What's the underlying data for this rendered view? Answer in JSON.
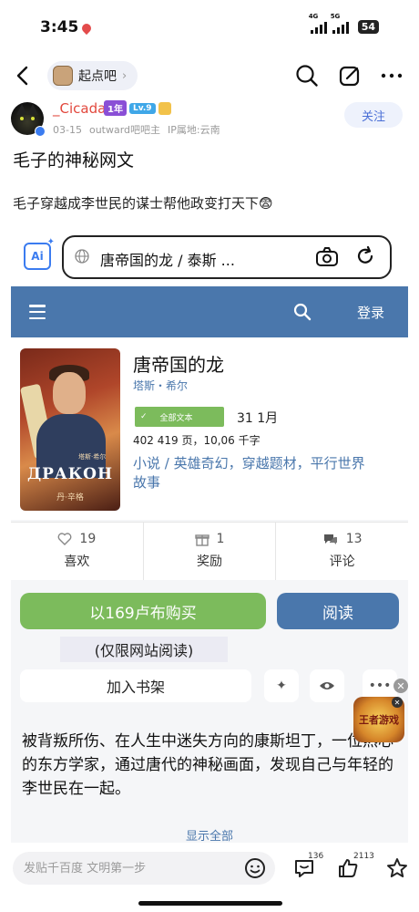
{
  "status": {
    "time": "3:45",
    "sig1": "4G",
    "sig2": "5G",
    "battery": "54"
  },
  "nav": {
    "forum_name": "起点吧"
  },
  "post": {
    "username": "_Cicada",
    "badge_year": "1年",
    "badge_level": "Lv.9",
    "date": "03-15",
    "role": "outward吧吧主",
    "ip": "IP属地:云南",
    "follow_label": "关注",
    "title": "毛子的神秘网文",
    "body": "毛子穿越成李世民的谋士帮他政变打天下😨"
  },
  "embed": {
    "ai_label": "Ai",
    "url_text": "唐帝国的龙 / 泰斯 ...",
    "login_label": "登录",
    "cover_title": "ДРАКОН",
    "cover_author": "丹·辛格",
    "cover_author_small": "塔斯·希尔",
    "book_title": "唐帝国的龙",
    "book_author": "塔斯・希尔",
    "fulltext_label": "全部文本",
    "date": "31 1月",
    "pages": "402 419 页，10,06 千字",
    "genre": "小说 / 英雄奇幻，穿越题材，平行世界故事",
    "stats": [
      {
        "count": "19",
        "label": "喜欢"
      },
      {
        "count": "1",
        "label": "奖励"
      },
      {
        "count": "13",
        "label": "评论"
      }
    ],
    "buy_label": "以169卢布购买",
    "read_label": "阅读",
    "site_only": "(仅限网站阅读)",
    "shelf_label": "加入书架",
    "more_label": "•••",
    "description": "被背叛所伤、在人生中迷失方向的康斯坦丁，一位热心的东方学家，通过唐代的神秘画面，发现自己与年轻的李世民在一起。",
    "show_all": "显示全部"
  },
  "ad": {
    "logo_text": "王者游戏"
  },
  "bottom": {
    "placeholder": "发贴千百度 文明第一步",
    "comments_count": "136",
    "likes_count": "2113"
  }
}
